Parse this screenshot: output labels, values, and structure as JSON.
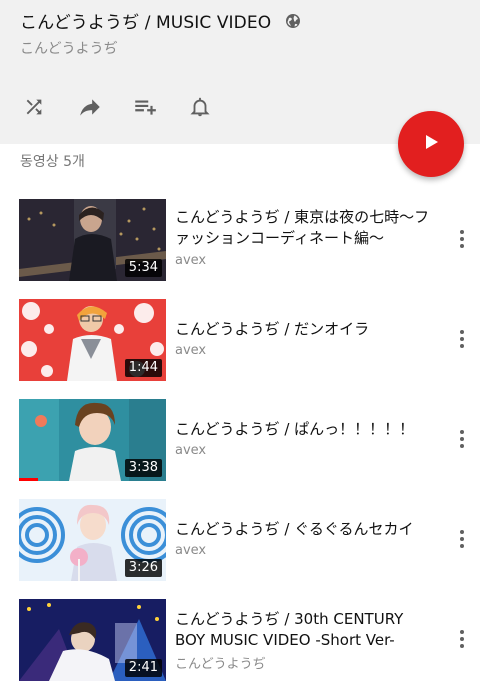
{
  "playlist": {
    "title": "こんどうようぢ / MUSIC VIDEO",
    "channel": "こんどうようぢ",
    "privacy_icon": "globe-icon",
    "video_count": "동영상 5개",
    "colors": {
      "header_bg": "#f1f1f1",
      "play_button": "#e21f1f",
      "progress": "#ff0000"
    }
  },
  "actions": [
    {
      "icon": "shuffle-icon"
    },
    {
      "icon": "share-icon"
    },
    {
      "icon": "add-to-queue-icon"
    },
    {
      "icon": "bell-icon"
    }
  ],
  "videos": [
    {
      "title": "こんどうようぢ / 東京は夜の七時～ファッションコーディネート編～",
      "channel": "avex",
      "duration": "5:34"
    },
    {
      "title": "こんどうようぢ / だンオイラ",
      "channel": "avex",
      "duration": "1:44"
    },
    {
      "title": "こんどうようぢ / ぱんっ！！！！！",
      "channel": "avex",
      "duration": "3:38",
      "watched_fraction": 0.13
    },
    {
      "title": "こんどうようぢ / ぐるぐるんセカイ",
      "channel": "avex",
      "duration": "3:26"
    },
    {
      "title": "こんどうようぢ / 30th CENTURY BOY MUSIC VIDEO -Short Ver-",
      "channel": "こんどうようぢ",
      "duration": "2:41"
    }
  ]
}
